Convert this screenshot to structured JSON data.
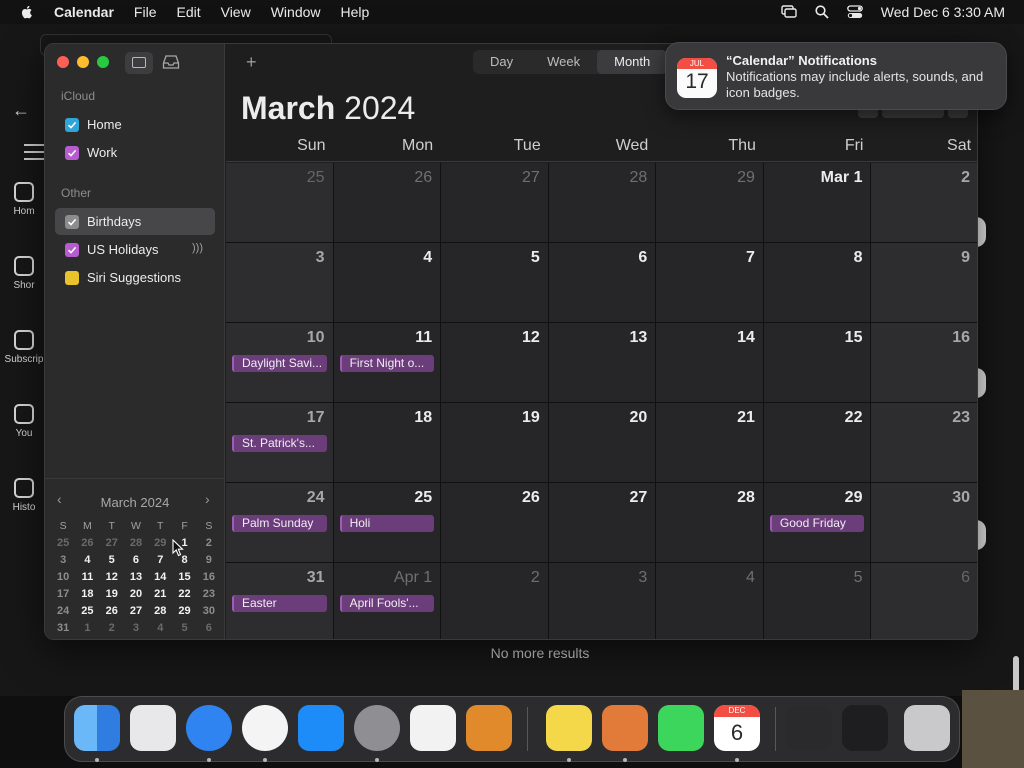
{
  "menubar": {
    "app_name": "Calendar",
    "items": [
      "File",
      "Edit",
      "View",
      "Window",
      "Help"
    ],
    "clock": "Wed Dec 6  3:30 AM"
  },
  "background_window": {
    "sidebar": [
      "Hom",
      "Shor",
      "Subscrip",
      "You",
      "Histo"
    ],
    "footer": "No more results"
  },
  "toolbar": {
    "add": "+",
    "views": [
      "Day",
      "Week",
      "Month"
    ],
    "active_view": "Month"
  },
  "sidebar": {
    "groups": [
      {
        "label": "iCloud",
        "calendars": [
          {
            "name": "Home",
            "color": "#2fa5d8"
          },
          {
            "name": "Work",
            "color": "#b65ccf"
          }
        ]
      },
      {
        "label": "Other",
        "calendars": [
          {
            "name": "Birthdays",
            "color": "#8c8c8e",
            "selected": true
          },
          {
            "name": "US Holidays",
            "color": "#b65ccf",
            "icon": "broadcast-icon"
          },
          {
            "name": "Siri Suggestions",
            "color": "#e8c32b"
          }
        ]
      }
    ]
  },
  "mini_calendar": {
    "title": "March 2024",
    "weekday_headers": [
      "S",
      "M",
      "T",
      "W",
      "T",
      "F",
      "S"
    ],
    "weeks": [
      [
        "25",
        "26",
        "27",
        "28",
        "29",
        "1",
        "2"
      ],
      [
        "3",
        "4",
        "5",
        "6",
        "7",
        "8",
        "9"
      ],
      [
        "10",
        "11",
        "12",
        "13",
        "14",
        "15",
        "16"
      ],
      [
        "17",
        "18",
        "19",
        "20",
        "21",
        "22",
        "23"
      ],
      [
        "24",
        "25",
        "26",
        "27",
        "28",
        "29",
        "30"
      ],
      [
        "31",
        "1",
        "2",
        "3",
        "4",
        "5",
        "6"
      ]
    ],
    "out_of_month": [
      [
        0,
        0
      ],
      [
        0,
        1
      ],
      [
        0,
        2
      ],
      [
        0,
        3
      ],
      [
        0,
        4
      ],
      [
        5,
        1
      ],
      [
        5,
        2
      ],
      [
        5,
        3
      ],
      [
        5,
        4
      ],
      [
        5,
        5
      ],
      [
        5,
        6
      ]
    ]
  },
  "main": {
    "month": "March",
    "year": "2024",
    "weekday_headers": [
      "Sun",
      "Mon",
      "Tue",
      "Wed",
      "Thu",
      "Fri",
      "Sat"
    ],
    "weeks": [
      [
        {
          "n": "25",
          "muted": true
        },
        {
          "n": "26",
          "muted": true
        },
        {
          "n": "27",
          "muted": true
        },
        {
          "n": "28",
          "muted": true
        },
        {
          "n": "29",
          "muted": true
        },
        {
          "n": "Mar 1"
        },
        {
          "n": "2"
        }
      ],
      [
        {
          "n": "3"
        },
        {
          "n": "4"
        },
        {
          "n": "5"
        },
        {
          "n": "6"
        },
        {
          "n": "7"
        },
        {
          "n": "8"
        },
        {
          "n": "9"
        }
      ],
      [
        {
          "n": "10",
          "event": "Daylight Savi..."
        },
        {
          "n": "11",
          "event": "First Night o..."
        },
        {
          "n": "12"
        },
        {
          "n": "13"
        },
        {
          "n": "14"
        },
        {
          "n": "15"
        },
        {
          "n": "16"
        }
      ],
      [
        {
          "n": "17",
          "event": "St. Patrick's..."
        },
        {
          "n": "18"
        },
        {
          "n": "19"
        },
        {
          "n": "20"
        },
        {
          "n": "21"
        },
        {
          "n": "22"
        },
        {
          "n": "23"
        }
      ],
      [
        {
          "n": "24",
          "event": "Palm Sunday"
        },
        {
          "n": "25",
          "event": "Holi"
        },
        {
          "n": "26"
        },
        {
          "n": "27"
        },
        {
          "n": "28"
        },
        {
          "n": "29",
          "event": "Good Friday"
        },
        {
          "n": "30"
        }
      ],
      [
        {
          "n": "31",
          "event": "Easter"
        },
        {
          "n": "Apr 1",
          "muted": true,
          "event": "April Fools'..."
        },
        {
          "n": "2",
          "muted": true
        },
        {
          "n": "3",
          "muted": true
        },
        {
          "n": "4",
          "muted": true
        },
        {
          "n": "5",
          "muted": true
        },
        {
          "n": "6",
          "muted": true
        }
      ]
    ],
    "event_color": "#6b3d7a",
    "event_border": "#a15bb8"
  },
  "notification": {
    "icon_month": "JUL",
    "icon_day": "17",
    "title": "“Calendar” Notifications",
    "body": "Notifications may include alerts, sounds, and icon badges."
  },
  "dock": {
    "apps": [
      {
        "name": "finder",
        "color": "#3c8ff0"
      },
      {
        "name": "launchpad",
        "color": "#e8e8ea"
      },
      {
        "name": "safari",
        "color": "#2f84f2"
      },
      {
        "name": "chrome",
        "color": "#f4f4f4"
      },
      {
        "name": "app-store",
        "color": "#1e8cf8"
      },
      {
        "name": "system-settings",
        "color": "#8e8e93"
      },
      {
        "name": "textedit",
        "color": "#f2f2f2"
      },
      {
        "name": "garageband",
        "color": "#e08a2c"
      },
      {
        "name": "notes",
        "color": "#f5d74a"
      },
      {
        "name": "xampp",
        "color": "#e27a3a"
      },
      {
        "name": "messages",
        "color": "#3dd65c"
      },
      {
        "name": "calendar",
        "color": "#ffffff"
      },
      {
        "name": "window-preview-1",
        "color": "#2a2a2c"
      },
      {
        "name": "window-preview-2",
        "color": "#1e1e20"
      },
      {
        "name": "trash",
        "color": "#c9c9cc"
      }
    ],
    "calendar_icon_month": "DEC",
    "calendar_icon_day": "6"
  }
}
